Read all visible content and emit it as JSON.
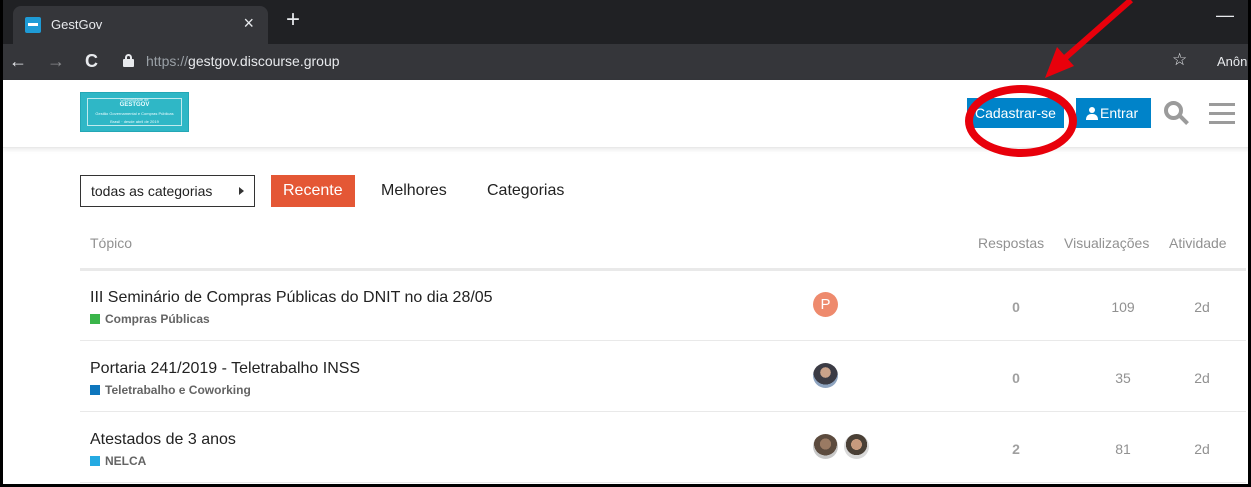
{
  "browser": {
    "tab_title": "GestGov",
    "tab_close": "×",
    "new_tab": "+",
    "minimize": "—",
    "url_scheme": "https://",
    "url_host": "gestgov.discourse.group",
    "profile": "Anônimo",
    "icons": [
      "back-arrow-icon",
      "forward-arrow-icon",
      "reload-icon",
      "lock-icon",
      "star-icon"
    ]
  },
  "header": {
    "logo_lines": [
      "Comunidade de",
      "GESTGOV",
      "Gestão Governamental e Compras Públicas",
      "Brasil · desde abril de 2019"
    ],
    "signup_label": "Cadastrar-se",
    "login_label": "Entrar",
    "accent_color": "#0083c9"
  },
  "nav": {
    "category_dropdown": "todas as categorias",
    "pills": [
      "Recente",
      "Melhores",
      "Categorias"
    ],
    "active_pill": "Recente",
    "active_color": "#e45735"
  },
  "table": {
    "headers": {
      "topic": "Tópico",
      "replies": "Respostas",
      "views": "Visualizações",
      "activity": "Atividade"
    },
    "rows": [
      {
        "title": "III Seminário de Compras Públicas do DNIT no dia 28/05",
        "category": "Compras Públicas",
        "category_color": "#3ab54a",
        "avatar_letter": "P",
        "replies": "0",
        "views": "109",
        "activity": "2d"
      },
      {
        "title": "Portaria 241/2019 - Teletrabalho INSS",
        "category": "Teletrabalho e Coworking",
        "category_color": "#0e76bd",
        "replies": "0",
        "views": "35",
        "activity": "2d"
      },
      {
        "title": "Atestados de 3 anos",
        "category": "NELCA",
        "category_color": "#25aae2",
        "replies": "2",
        "views": "81",
        "activity": "2d"
      }
    ]
  },
  "annotation": {
    "color": "#e8000b"
  }
}
